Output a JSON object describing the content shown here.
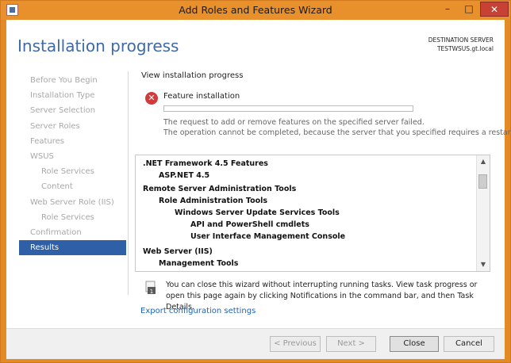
{
  "window": {
    "title": "Add Roles and Features Wizard",
    "minimize_glyph": "–",
    "maximize_glyph": "□",
    "close_glyph": "✕"
  },
  "header": {
    "page_title": "Installation progress",
    "destination_label": "DESTINATION SERVER",
    "destination_server": "TESTWSUS.gt.local"
  },
  "nav": {
    "items": [
      {
        "label": "Before You Begin"
      },
      {
        "label": "Installation Type"
      },
      {
        "label": "Server Selection"
      },
      {
        "label": "Server Roles"
      },
      {
        "label": "Features"
      },
      {
        "label": "WSUS"
      },
      {
        "label": "Role Services"
      },
      {
        "label": "Content"
      },
      {
        "label": "Web Server Role (IIS)"
      },
      {
        "label": "Role Services"
      },
      {
        "label": "Confirmation"
      },
      {
        "label": "Results"
      }
    ]
  },
  "main": {
    "view_progress": "View installation progress",
    "feature_installation": "Feature installation",
    "progress": 0,
    "error_line1": "The request to add or remove features on the specified server failed.",
    "error_line2": "The operation cannot be completed, because the server that you specified requires a restart.",
    "results": [
      ".NET Framework 4.5 Features",
      "ASP.NET 4.5",
      "Remote Server Administration Tools",
      "Role Administration Tools",
      "Windows Server Update Services Tools",
      "API and PowerShell cmdlets",
      "User Interface Management Console",
      "Web Server (IIS)",
      "Management Tools"
    ],
    "notification_text": "You can close this wizard without interrupting running tasks. View task progress or open this page again by clicking Notifications in the command bar, and then Task Details.",
    "export_link": "Export configuration settings"
  },
  "footer": {
    "previous": "< Previous",
    "next": "Next >",
    "close": "Close",
    "cancel": "Cancel"
  },
  "colors": {
    "title_bar": "#e8912c",
    "accent": "#2e5fa7",
    "page_title": "#3d6aa8",
    "error_icon": "#d23b3b"
  },
  "icons": {
    "app": "wizard-icon",
    "error": "error-icon",
    "notification": "flag-icon"
  }
}
